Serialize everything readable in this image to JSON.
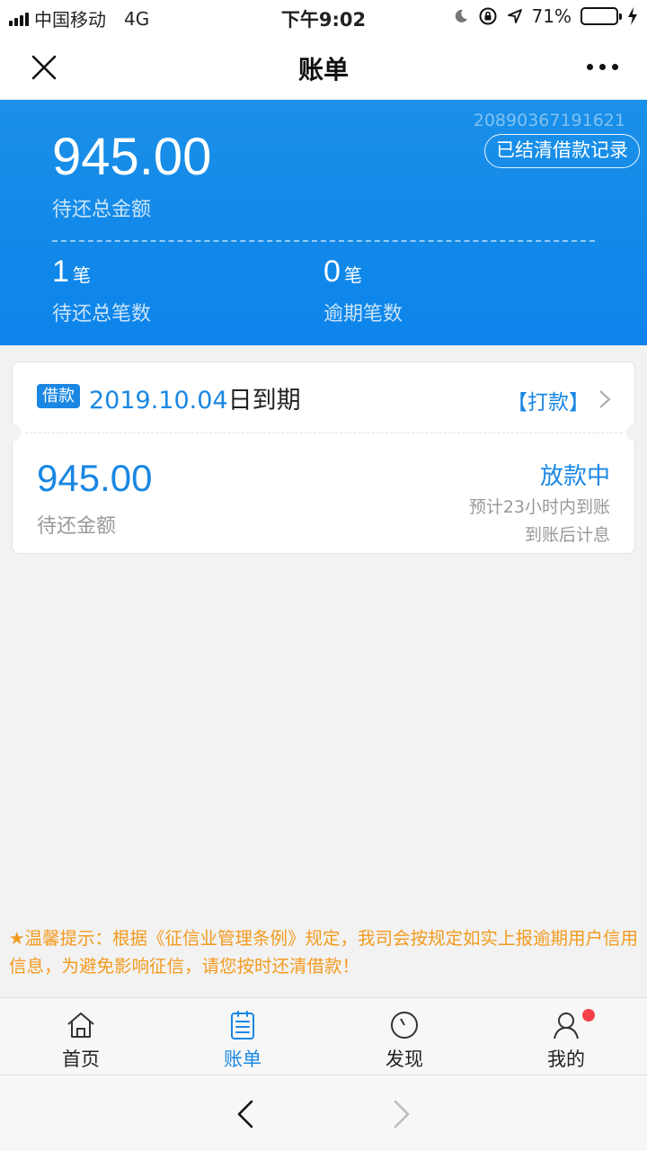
{
  "status_bar": {
    "carrier": "中国移动",
    "network": "4G",
    "time": "下午9:02",
    "battery_percent": "71%",
    "battery_level": 0.71,
    "icons": [
      "signal-icon",
      "moon-icon",
      "orientation-lock-icon",
      "location-icon",
      "battery-icon",
      "charging-icon"
    ]
  },
  "navbar": {
    "title": "账单",
    "icons": [
      "close-icon",
      "more-icon"
    ]
  },
  "summary": {
    "account_no": "20890367191621",
    "settled_link": "已结清借款记录",
    "total_amount": "945.00",
    "total_label": "待还总金额",
    "pending_count": "1",
    "pending_unit": "笔",
    "pending_label": "待还总笔数",
    "overdue_count": "0",
    "overdue_unit": "笔",
    "overdue_label": "逾期笔数"
  },
  "loan_card": {
    "tag": "借款",
    "due_date": "2019.10.04",
    "due_suffix": "日到期",
    "action": "【打款】",
    "amount": "945.00",
    "amount_label": "待还金额",
    "status": "放款中",
    "note_line1": "预计23小时内到账",
    "note_line2": "到账后计息"
  },
  "warning": "★温馨提示：根据《征信业管理条例》规定，我司会按规定如实上报逾期用户信用信息，为避免影响征信，请您按时还清借款！",
  "tabbar": {
    "items": [
      {
        "label": "首页",
        "icon": "home-icon",
        "active": false
      },
      {
        "label": "账单",
        "icon": "bill-icon",
        "active": true
      },
      {
        "label": "发现",
        "icon": "compass-icon",
        "active": false
      },
      {
        "label": "我的",
        "icon": "user-icon",
        "active": false,
        "badge": true
      }
    ]
  },
  "colors": {
    "accent": "#1a87e3",
    "hero_bg": "#0c84ea",
    "warning": "#f39a1e",
    "badge": "#f5424a",
    "battery": "#f5c400"
  }
}
